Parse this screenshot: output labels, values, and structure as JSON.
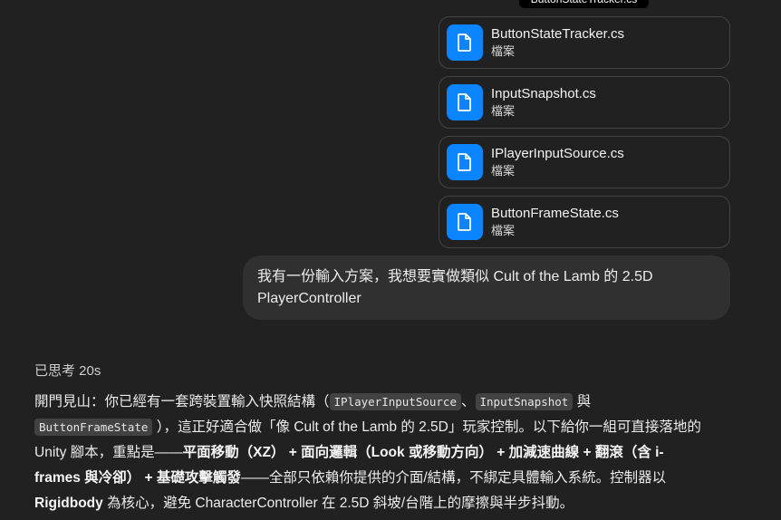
{
  "tooltip": "ButtonStateTracker.cs",
  "files": [
    {
      "name": "ButtonStateTracker.cs",
      "type": "檔案"
    },
    {
      "name": "InputSnapshot.cs",
      "type": "檔案"
    },
    {
      "name": "IPlayerInputSource.cs",
      "type": "檔案"
    },
    {
      "name": "ButtonFrameState.cs",
      "type": "檔案"
    }
  ],
  "user_message": {
    "line1": "我有一份輸入方案，我想要實做類似 Cult of the Lamb 的 2.5D",
    "line2": "PlayerController"
  },
  "assistant": {
    "thought": "已思考 20s",
    "p1": "開門見山：你已經有一套跨裝置輸入快照結構（",
    "code1": "IPlayerInputSource",
    "p2": "、",
    "code2": "InputSnapshot",
    "p3": "與",
    "code3": "ButtonFrameState",
    "p4": "），這正好適合做「像 Cult of the Lamb 的 2.5D」玩家控制。以下給你一組可直接落地的",
    "p5": "Unity 腳本，重點是——",
    "b1": "平面移動（XZ）",
    "p6": " + ",
    "b2": "面向邏輯（Look 或移動方向）",
    "p7": " + ",
    "b3": "加減速曲線",
    "p8": " + ",
    "b4": "翻滾（含 i-",
    "b5": "frames 與冷卻）",
    "p9": " + ",
    "b6": "基礎攻擊觸發",
    "p10": "——全部只依賴你提供的介面/結構，不綁定具體輸入系統。控制器以",
    "b7": "Rigidbody",
    "p11": " 為核心，避免 CharacterController 在 2.5D 斜坡/台階上的摩擦與半步抖動。"
  }
}
